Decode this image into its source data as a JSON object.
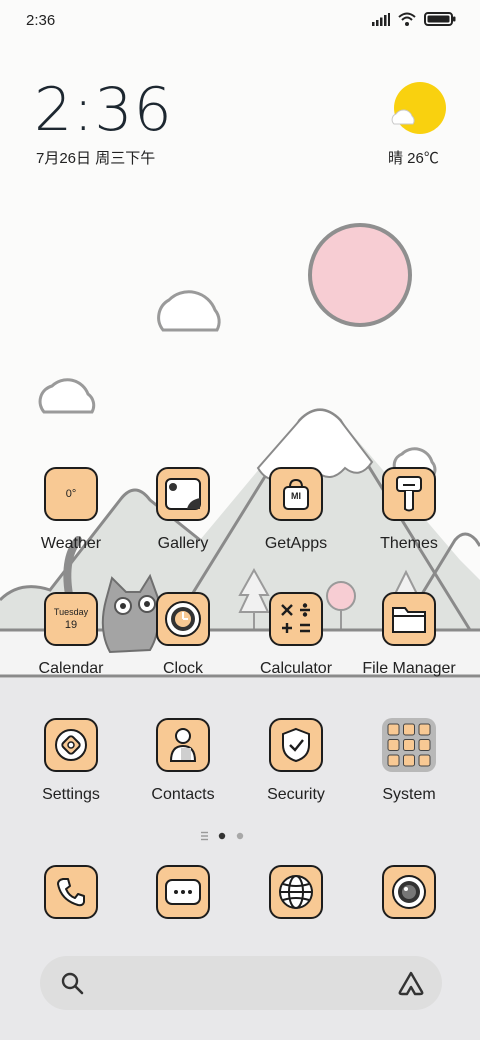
{
  "status_bar": {
    "time": "2:36",
    "icons": [
      "signal-icon",
      "wifi-icon",
      "battery-icon"
    ]
  },
  "clock_widget": {
    "time": "2:36",
    "date": "7月26日 周三下午"
  },
  "weather_widget": {
    "condition_temp": "晴 26℃",
    "icon": "sun-cloud-icon"
  },
  "apps": {
    "row1": [
      {
        "label": "Weather",
        "icon": "weather-icon",
        "tile_text": "0°"
      },
      {
        "label": "Gallery",
        "icon": "gallery-icon"
      },
      {
        "label": "GetApps",
        "icon": "getapps-icon",
        "tile_text": "MI"
      },
      {
        "label": "Themes",
        "icon": "themes-icon"
      }
    ],
    "row2": [
      {
        "label": "Calendar",
        "icon": "calendar-icon",
        "day_name": "Tuesday",
        "day_num": "19"
      },
      {
        "label": "Clock",
        "icon": "clock-icon"
      },
      {
        "label": "Calculator",
        "icon": "calculator-icon"
      },
      {
        "label": "File Manager",
        "icon": "folder-icon"
      }
    ],
    "row3": [
      {
        "label": "Settings",
        "icon": "settings-icon"
      },
      {
        "label": "Contacts",
        "icon": "contacts-icon"
      },
      {
        "label": "Security",
        "icon": "security-icon"
      },
      {
        "label": "System",
        "icon": "system-folder-icon"
      }
    ]
  },
  "dock": [
    {
      "name": "phone",
      "icon": "phone-icon"
    },
    {
      "name": "messages",
      "icon": "messages-icon"
    },
    {
      "name": "browser",
      "icon": "globe-icon"
    },
    {
      "name": "camera",
      "icon": "camera-icon"
    }
  ],
  "page_indicator": {
    "pages": 2,
    "current": 1
  },
  "search": {
    "icon": "search-icon",
    "assistant_icon": "assistant-icon"
  },
  "colors": {
    "tile": "#f8c994",
    "outline": "#1d1d1d",
    "sun": "#f9d10f",
    "moon": "#f7cdd3",
    "mountain": "#dfe2df"
  }
}
